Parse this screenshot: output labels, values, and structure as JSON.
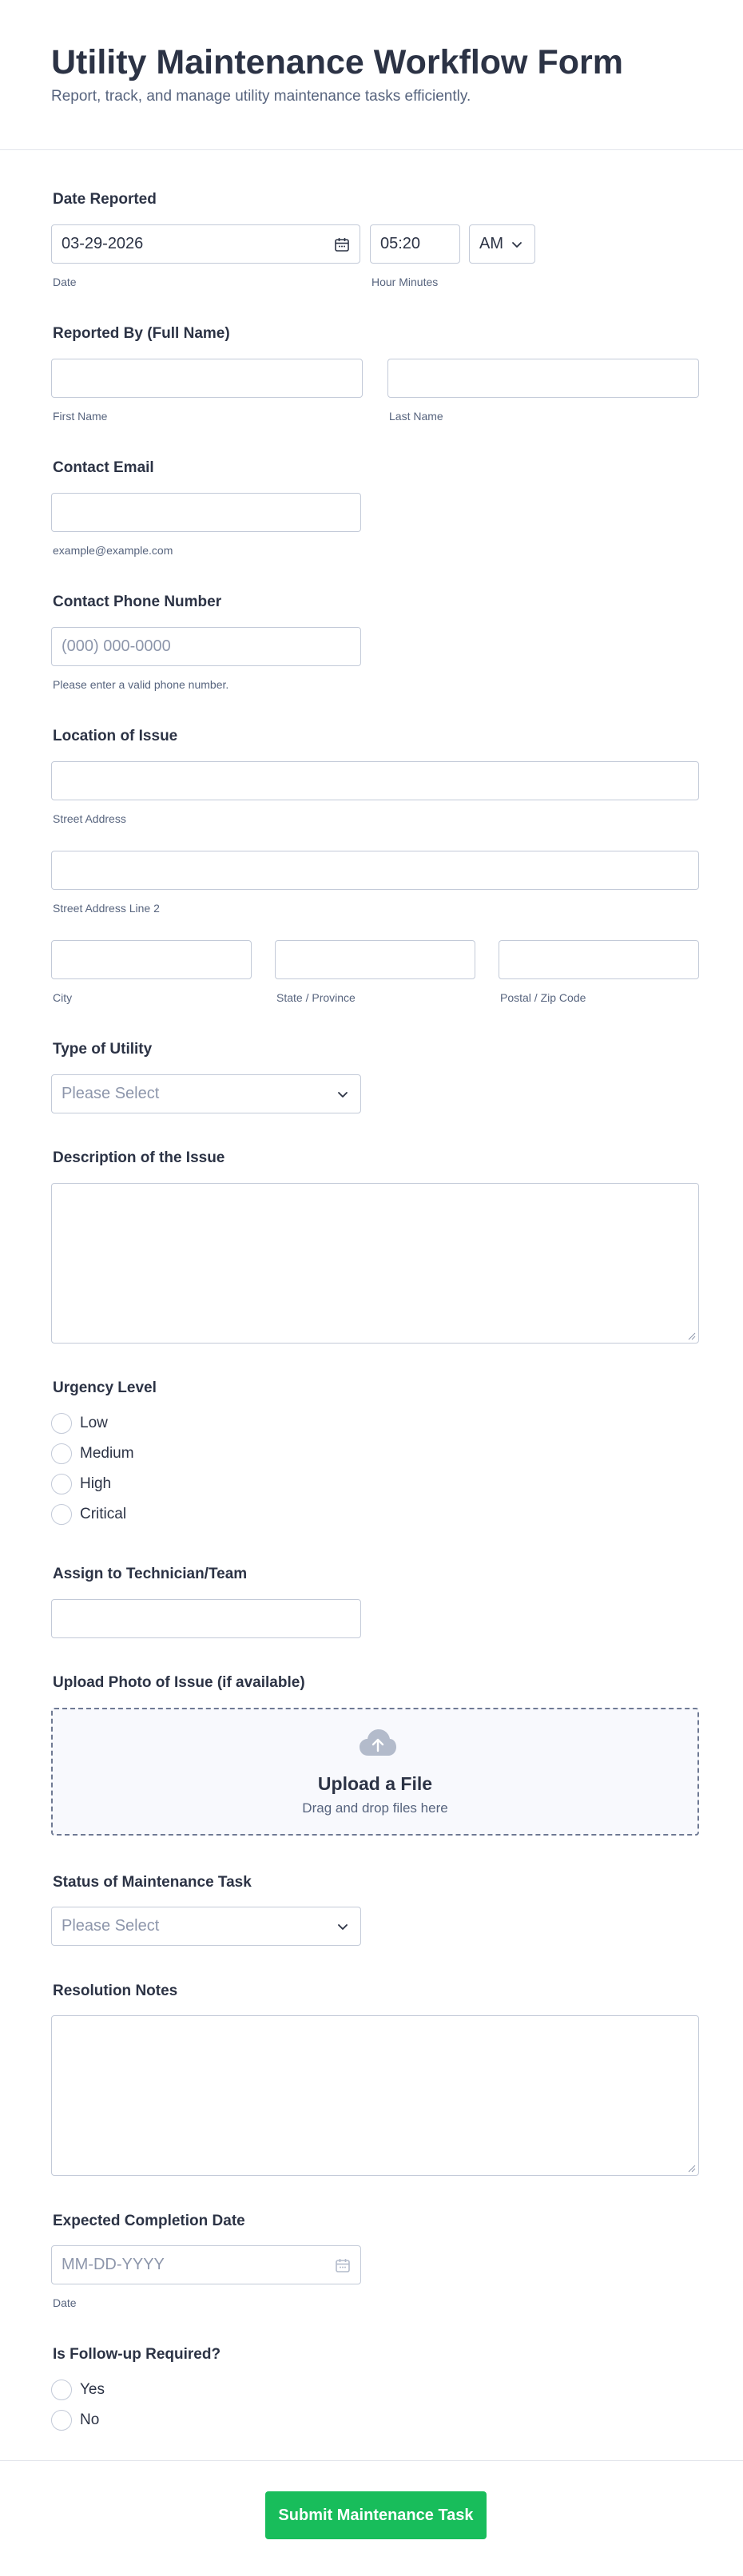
{
  "header": {
    "title": "Utility Maintenance Workflow Form",
    "subtitle": "Report, track, and manage utility maintenance tasks efficiently."
  },
  "date_reported": {
    "label": "Date Reported",
    "date_value": "03-29-2026",
    "date_sublabel": "Date",
    "time_value": "05:20",
    "time_sublabel": "Hour Minutes",
    "ampm_value": "AM"
  },
  "reported_by": {
    "label": "Reported By (Full Name)",
    "first_sublabel": "First Name",
    "last_sublabel": "Last Name"
  },
  "contact_email": {
    "label": "Contact Email",
    "sublabel": "example@example.com"
  },
  "contact_phone": {
    "label": "Contact Phone Number",
    "placeholder": "(000) 000-0000",
    "sublabel": "Please enter a valid phone number."
  },
  "location": {
    "label": "Location of Issue",
    "street_sublabel": "Street Address",
    "street2_sublabel": "Street Address Line 2",
    "city_sublabel": "City",
    "state_sublabel": "State / Province",
    "zip_sublabel": "Postal / Zip Code"
  },
  "utility_type": {
    "label": "Type of Utility",
    "placeholder": "Please Select"
  },
  "description": {
    "label": "Description of the Issue"
  },
  "urgency": {
    "label": "Urgency Level",
    "options": [
      "Low",
      "Medium",
      "High",
      "Critical"
    ]
  },
  "assign": {
    "label": "Assign to Technician/Team"
  },
  "upload": {
    "label": "Upload Photo of Issue (if available)",
    "title": "Upload a File",
    "subtitle": "Drag and drop files here"
  },
  "status": {
    "label": "Status of Maintenance Task",
    "placeholder": "Please Select"
  },
  "resolution": {
    "label": "Resolution Notes"
  },
  "expected_date": {
    "label": "Expected Completion Date",
    "placeholder": "MM-DD-YYYY",
    "sublabel": "Date"
  },
  "followup": {
    "label": "Is Follow-up Required?",
    "options": [
      "Yes",
      "No"
    ]
  },
  "submit": {
    "label": "Submit Maintenance Task"
  },
  "colors": {
    "submit_button": "#18bd5b",
    "text": "#2c3345",
    "sublabel": "#57647e",
    "border": "#c3cad8"
  },
  "icons": [
    "calendar-icon",
    "chevron-down-icon",
    "upload-cloud-icon",
    "resize-grip-icon"
  ]
}
